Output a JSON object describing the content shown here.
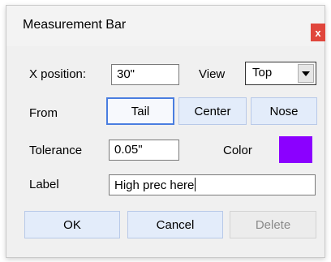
{
  "window": {
    "title": "Measurement Bar",
    "close_label": "x"
  },
  "position": {
    "label": "X position:",
    "value": "30\""
  },
  "view": {
    "label": "View",
    "selected": "Top"
  },
  "from": {
    "label": "From",
    "options": [
      {
        "label": "Tail",
        "selected": true
      },
      {
        "label": "Center",
        "selected": false
      },
      {
        "label": "Nose",
        "selected": false
      }
    ]
  },
  "tolerance": {
    "label": "Tolerance",
    "value": "0.05\""
  },
  "color": {
    "label": "Color",
    "value": "#8b00ff"
  },
  "label_field": {
    "label": "Label",
    "value": "High prec here"
  },
  "buttons": {
    "ok": "OK",
    "cancel": "Cancel",
    "delete": "Delete",
    "delete_enabled": false
  },
  "icons": {
    "close": "close-icon",
    "dropdown": "chevron-down-icon"
  }
}
